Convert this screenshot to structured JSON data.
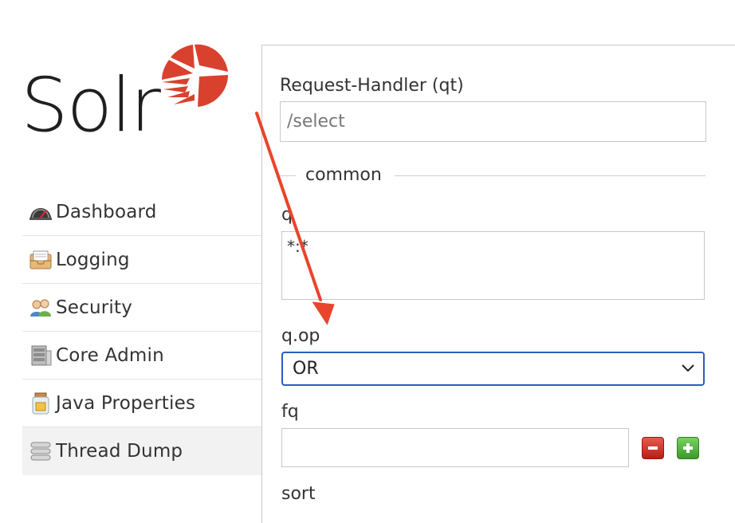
{
  "logo": {
    "wordmark": "Solr"
  },
  "sidebar": {
    "items": [
      {
        "label": "Dashboard",
        "icon": "dashboard-gauge-icon"
      },
      {
        "label": "Logging",
        "icon": "logging-inbox-icon"
      },
      {
        "label": "Security",
        "icon": "security-users-icon"
      },
      {
        "label": "Core Admin",
        "icon": "core-admin-server-icon"
      },
      {
        "label": "Java Properties",
        "icon": "java-properties-jar-icon"
      },
      {
        "label": "Thread Dump",
        "icon": "thread-dump-stack-icon",
        "active": true
      }
    ]
  },
  "query": {
    "request_handler_label": "Request-Handler (qt)",
    "request_handler_value": "/select",
    "common_legend": "common",
    "q_label": "q",
    "q_value": "*:*",
    "qop_label": "q.op",
    "qop_value": "OR",
    "fq_label": "fq",
    "fq_value": "",
    "sort_label": "sort"
  },
  "colors": {
    "accent": "#2a5ebd",
    "logo_red": "#d9412f",
    "annotation_arrow": "#e8452c",
    "remove_red": "#c9302c",
    "add_green": "#4cae4c"
  }
}
